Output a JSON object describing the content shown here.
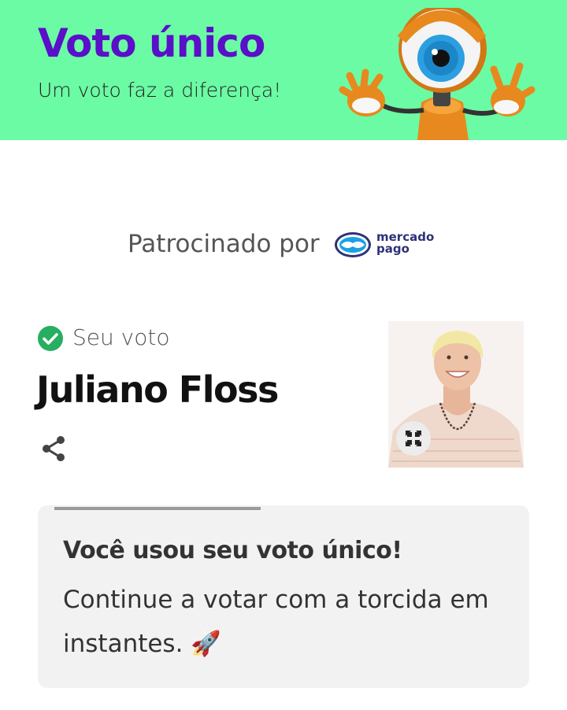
{
  "header": {
    "title": "Voto único",
    "subtitle": "Um voto faz a diferença!",
    "background_color": "#6bfba4",
    "title_color": "#5a0fc8",
    "mascot_icon": "big-brother-eye-mascot"
  },
  "sponsor": {
    "label": "Patrocinado por",
    "logo_line1": "mercado",
    "logo_line2": "pago",
    "logo_icon": "handshake-logo"
  },
  "vote": {
    "status_label": "Seu voto",
    "status_icon": "check-circle-icon",
    "status_color": "#27ae60",
    "candidate_name": "Juliano Floss",
    "share_icon": "share-icon",
    "expand_icon": "expand-icon"
  },
  "notice": {
    "title": "Você usou seu voto único!",
    "body": "Continue a votar com a torcida em instantes. 🚀",
    "progress": 0.45
  }
}
